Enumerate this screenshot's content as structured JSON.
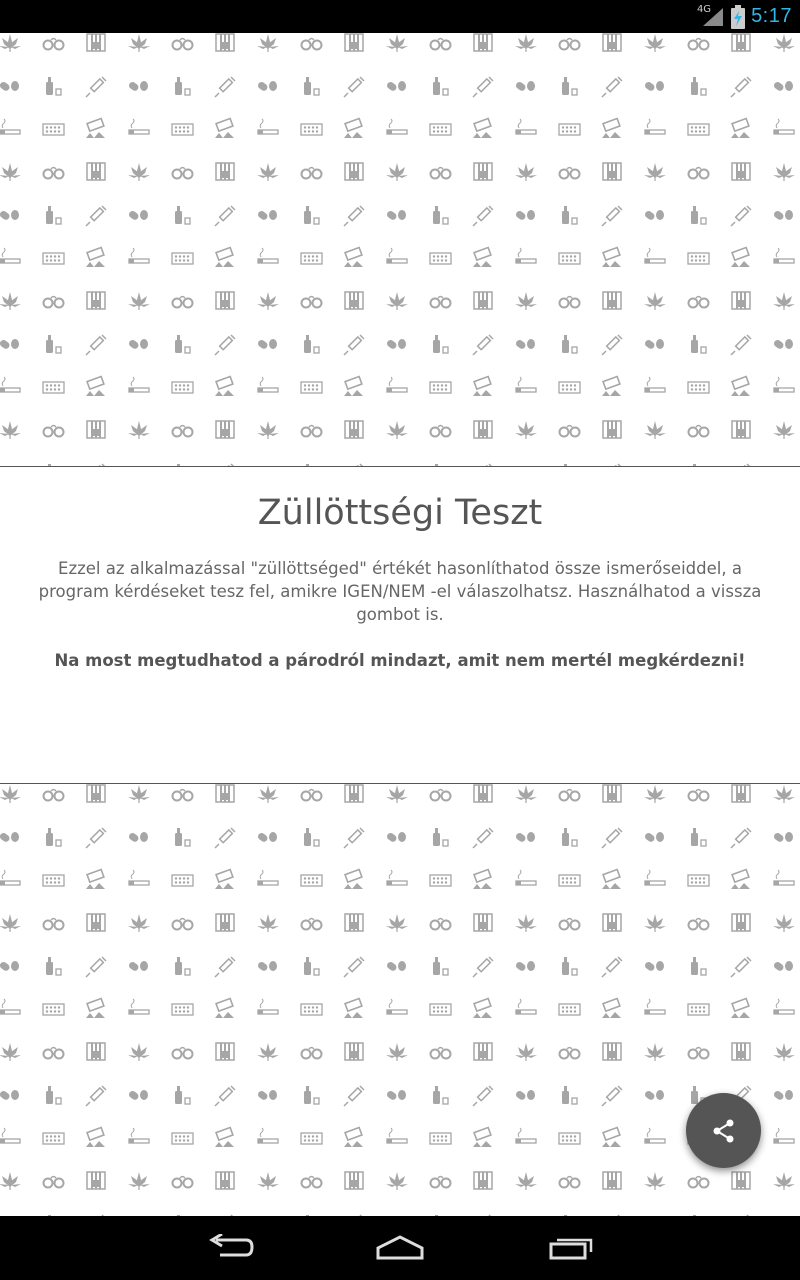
{
  "status_bar": {
    "network_type": "4G",
    "time": "5:17",
    "icons": [
      "signal-icon",
      "battery-charging-icon"
    ]
  },
  "background_pattern": {
    "icons": [
      "cannabis-leaf-icon",
      "handcuffs-icon",
      "prison-bars-icon",
      "pills-icon",
      "bottle-glass-icon",
      "syringe-icon",
      "cigarette-icon",
      "pill-blister-icon",
      "powder-card-icon"
    ],
    "color": "#a6a6a6"
  },
  "intro": {
    "title": "Züllöttségi Teszt",
    "description": "Ezzel az alkalmazással \"züllöttséged\" értékét hasonlíthatod össze ismerőseiddel, a program kérdéseket tesz fel, amikre IGEN/NEM -el válaszolhatsz. Használhatod a vissza gombot is.",
    "tagline": "Na most megtudhatod a párodról mindazt, amit nem mertél megkérdezni!"
  },
  "fab": {
    "icon": "share-icon",
    "color": "#555555"
  },
  "nav_bar": {
    "buttons": [
      "back-icon",
      "home-icon",
      "recent-apps-icon"
    ]
  }
}
